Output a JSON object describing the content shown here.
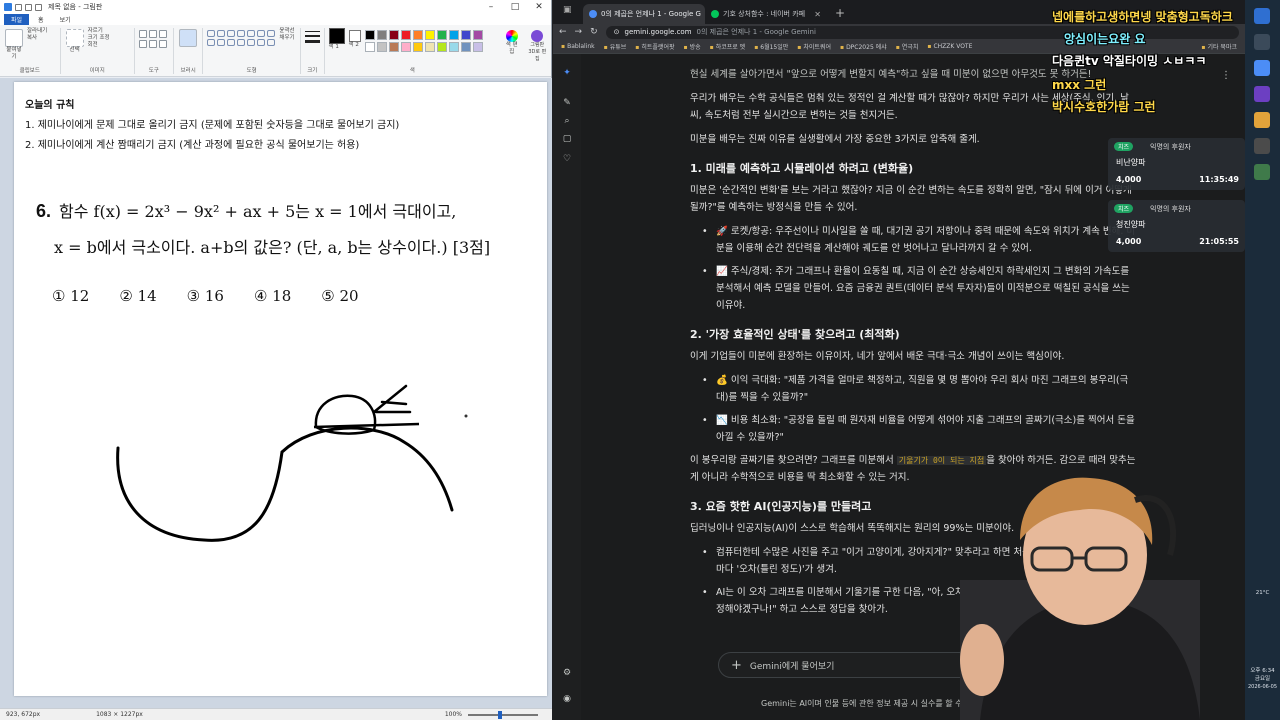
{
  "paint": {
    "title": "제목 없음 - 그림판",
    "ribbon_tabs": [
      "파일",
      "홈",
      "보기"
    ],
    "groups": {
      "clipboard": {
        "label": "클립보드",
        "paste": "붙여넣기",
        "cut": "잘라내기",
        "copy": "복사"
      },
      "image": {
        "label": "이미지",
        "select": "선택",
        "crop": "자르기",
        "resize": "크기 조정",
        "rotate": "회전"
      },
      "tools": {
        "label": "도구"
      },
      "brushes": {
        "label": "브러시"
      },
      "shapes": {
        "label": "도형",
        "outline": "윤곽선",
        "fill": "채우기"
      },
      "size": {
        "label": "크기"
      },
      "colors": {
        "label": "색",
        "color1": "색 1",
        "color2": "색 2",
        "edit": "색 편집",
        "paint3d": "그림판 3D로 편집"
      }
    },
    "rules": {
      "heading": "오늘의 규칙",
      "rule1": "1. 제미나이에게 문제 그대로 올리기 금지 (문제에 포함된 숫자등을 그대로 물어보기 금지)",
      "rule2": "2. 제미나이에게 계산 짬때리기 금지 (계산 과정에 필요한 공식 물어보기는 허용)"
    },
    "problem": {
      "number": "6.",
      "line1": "함수 f(x) = 2x³ − 9x² + ax + 5는 x = 1에서 극대이고,",
      "line2": "x = b에서 극소이다. a+b의 값은? (단, a, b는 상수이다.) [3점]",
      "choices": [
        "① 12",
        "② 14",
        "③ 16",
        "④ 18",
        "⑤ 20"
      ]
    },
    "status": {
      "cursor": "923, 672px",
      "dimensions": "1083 × 1227px",
      "zoom": "100%"
    }
  },
  "chrome": {
    "tabs": [
      {
        "label": "0의 제곱은 언제나 1 - Google G",
        "active": true
      },
      {
        "label": "기호 상처함수 : 네이버 카페",
        "active": false
      }
    ],
    "url_domain": "gemini.google.com",
    "url_title": "0의 제곱은 언제나 1 - Google Gemini",
    "bookmarks": [
      "Bablalink",
      "유튜브",
      "히트플랫어팟",
      "방송",
      "하코프로 멧",
      "6월15일만",
      "차이트쿼어",
      "DPC2025 에샤",
      "연극치",
      "CHZZK VOTE"
    ],
    "bookmarks_more": "기타 북마크"
  },
  "gemini": {
    "intro_muted": "현실 세계를 살아가면서 \"앞으로 어떻게 변할지 예측\"하고 싶을 때 미분이 없으면 아무것도 못 하거든!",
    "intro1": "우리가 배우는 수학 공식들은 멈춰 있는 정적인 걸 계산할 때가 많잖아? 하지만 우리가 사는 세상(주식, 인기, 날씨, 속도처럼 전부 실시간으로 변하는 것들 천지거든.",
    "intro2": "미분을 배우는 진짜 이유를 실생활에서 가장 중요한 3가지로 압축해 줄게.",
    "s1_title": "1. 미래를 예측하고 시뮬레이션 하려고 (변화율)",
    "s1_body": "미분은 '순간적인 변화'를 보는 거라고 했잖아? 지금 이 순간 변하는 속도를 정확히 알면, \"잠시 뒤에 이거 어떻게 될까?\"를 예측하는 방정식을 만들 수 있어.",
    "s1_b1": "🚀 로켓/항공: 우주선이나 미사일을 쏠 때, 대기권 공기 저항이나 중력 때문에 속도와 위치가 계속 변해. 미분을 이용해 순간 전단력을 계산해야 궤도를 안 벗어나고 달나라까지 갈 수 있어.",
    "s1_b2": "📈 주식/경제: 주가 그래프나 환율이 요동칠 때, 지금 이 순간 상승세인지 하락세인지 그 변화의 가속도를 분석해서 예측 모델을 만들어. 요즘 금융권 퀀트(데이터 분석 투자자)들이 미적분으로 떡칠된 공식을 쓰는 이유야.",
    "s2_title": "2. '가장 효율적인 상태'를 찾으려고 (최적화)",
    "s2_body": "이게 기업들이 미분에 환장하는 이유이자, 네가 앞에서 배운 극대·극소 개념이 쓰이는 핵심이야.",
    "s2_b1": "💰 이익 극대화: \"제품 가격을 얼마로 책정하고, 직원을 몇 명 뽑아야 우리 회사 마진 그래프의 봉우리(극대)를 찍을 수 있을까?\"",
    "s2_b2": "📉 비용 최소화: \"공장을 돌릴 때 원자재 비율을 어떻게 섞어야 지출 그래프의 골짜기(극소)를 찍어서 돈을 아낄 수 있을까?\"",
    "s2_tail_a": "이 봉우리랑 골짜기를 찾으려면? 그래프를 미분해서",
    "s2_tail_code": "기울기가 0이 되는 지점",
    "s2_tail_b": "을 찾아야 하거든. 감으로 때려 맞추는 게 아니라 수학적으로 비용을 딱 최소화할 수 있는 거지.",
    "s3_title": "3. 요즘 핫한 AI(인공지능)를 만들려고",
    "s3_body": "딥러닝이나 인공지능(AI)이 스스로 학습해서 똑똑해지는 원리의 99%는 미분이야.",
    "s3_b1": "컴퓨터한테 수많은 사진을 주고 \"이거 고양이게, 강아지게?\" 맞추라고 하면 처음엔 틀리겠지? 오답을 낼 때마다 '오차(틀린 정도)'가 생겨.",
    "s3_b2": "AI는 이 오차 그래프를 미분해서 기울기를 구한 다음, \"아, 오차를 줄이려면(골짜기 쪽으로) 계산 공식을 수정해야겠구나!\" 하고 스스로 정답을 찾아가.",
    "ask_placeholder": "Gemini에게 물어보기",
    "footer": "Gemini는 AI이며 인물 등에 관한 정보 제공 시 실수를 할 수 있습니다."
  },
  "overlay": {
    "text1": "넵에를하고생하면넹 맞춤형고독하크",
    "text2": "앙심이는요완 요",
    "text3": "다음퀸tv 악질타이밍 ㅅㅂㅋㅋ",
    "text4": "mxx 그런",
    "text5": "박시수호한가람 그런",
    "donations": [
      {
        "badge": "치즈",
        "who": "익명의 후원자",
        "message": "비난양파",
        "amount": "4,000",
        "time": "11:35:49"
      },
      {
        "badge": "치즈",
        "who": "익명의 후원자",
        "message": "청진양파",
        "amount": "4,000",
        "time": "21:05:55"
      }
    ]
  },
  "taskbar": {
    "temperature": "21°C",
    "time": "오후 6:34",
    "day": "금요일",
    "date": "2026-06-05"
  },
  "colors": {
    "paint_accent": "#1f5fbf",
    "gemini_bg": "#1b1c1d",
    "donation_badge": "#1fa362"
  }
}
